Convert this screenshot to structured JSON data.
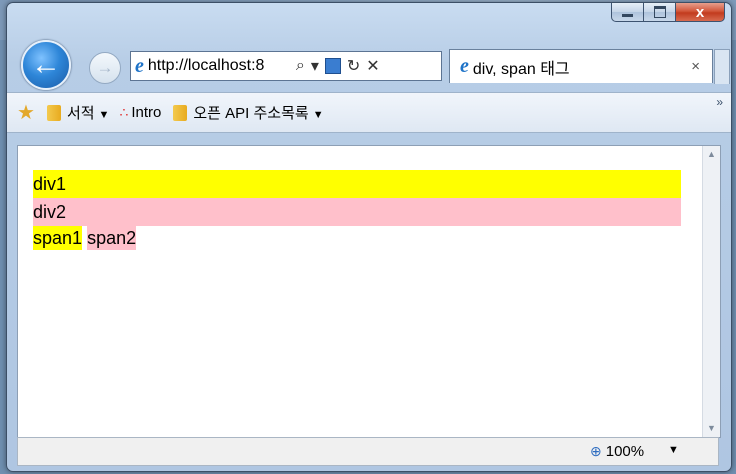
{
  "window": {
    "caption": {
      "minimize": "",
      "maximize": "",
      "close": "x"
    }
  },
  "nav": {
    "back_glyph": "←",
    "forward_glyph": "→",
    "address_url": "http://localhost:8",
    "search_glyph": "⌕",
    "dropdown_glyph": "▾",
    "refresh_glyph": "↻",
    "stop_glyph": "✕"
  },
  "tab": {
    "title": "div, span 태그",
    "close_glyph": "×"
  },
  "favorites": {
    "items": [
      {
        "label": "서적",
        "has_menu": true
      },
      {
        "label": "Intro",
        "has_menu": false
      },
      {
        "label": "오픈 API 주소목록",
        "has_menu": true
      }
    ],
    "overflow": "»"
  },
  "page": {
    "div1": "div1",
    "div2": "div2",
    "span1": "span1",
    "span2": "span2",
    "colors": {
      "div1": "#ffff00",
      "div2": "#ffc0cb"
    }
  },
  "status": {
    "zoom": "100%"
  }
}
